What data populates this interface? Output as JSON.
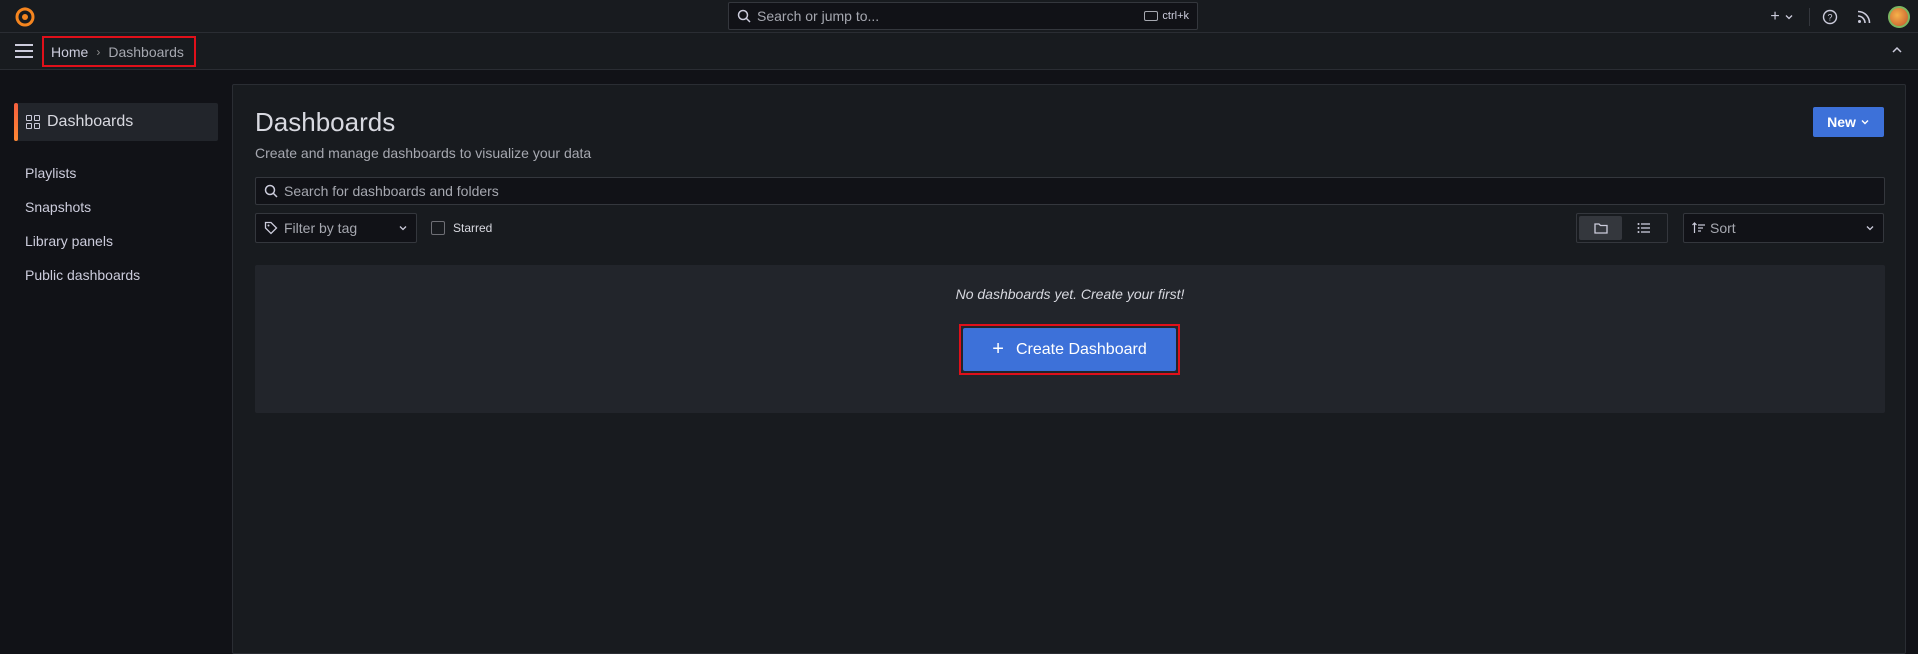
{
  "topbar": {
    "search_placeholder": "Search or jump to...",
    "shortcut": "ctrl+k",
    "plus_label": "+",
    "help_label": "?"
  },
  "breadcrumb": {
    "home": "Home",
    "separator": "›",
    "current": "Dashboards"
  },
  "sidebar": {
    "active": "Dashboards",
    "items": [
      {
        "label": "Playlists"
      },
      {
        "label": "Snapshots"
      },
      {
        "label": "Library panels"
      },
      {
        "label": "Public dashboards"
      }
    ]
  },
  "main": {
    "title": "Dashboards",
    "subtitle": "Create and manage dashboards to visualize your data",
    "new_button": "New",
    "search_placeholder": "Search for dashboards and folders",
    "tag_filter": "Filter by tag",
    "starred_label": "Starred",
    "sort_label": "Sort",
    "empty_message": "No dashboards yet. Create your first!",
    "create_button": "Create Dashboard",
    "create_icon": "+"
  },
  "colors": {
    "accent": "#3d71d9",
    "highlight": "#e0101a",
    "brand": "#f55f3e"
  }
}
